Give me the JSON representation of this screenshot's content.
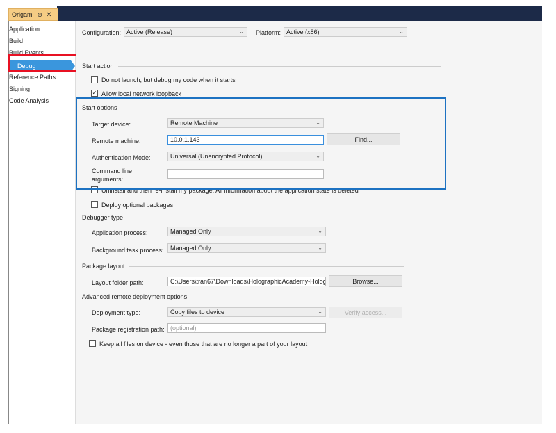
{
  "tab": {
    "title": "Origami",
    "pin_glyph": "⊕",
    "close_glyph": "✕"
  },
  "sidebar": {
    "items": [
      {
        "label": "Application"
      },
      {
        "label": "Build"
      },
      {
        "label": "Build Events"
      },
      {
        "label": "Debug"
      },
      {
        "label": "Reference Paths"
      },
      {
        "label": "Signing"
      },
      {
        "label": "Code Analysis"
      }
    ]
  },
  "config": {
    "configuration_label": "Configuration:",
    "configuration_value": "Active (Release)",
    "platform_label": "Platform:",
    "platform_value": "Active (x86)"
  },
  "start_action": {
    "title": "Start action",
    "do_not_launch": "Do not launch, but debug my code when it starts",
    "allow_loopback": "Allow local network loopback"
  },
  "start_options": {
    "title": "Start options",
    "target_device_label": "Target device:",
    "target_device_value": "Remote Machine",
    "remote_machine_label": "Remote machine:",
    "remote_machine_value": "10.0.1.143",
    "find_label": "Find...",
    "auth_mode_label": "Authentication Mode:",
    "auth_mode_value": "Universal (Unencrypted Protocol)",
    "cmdline_label_1": "Command line",
    "cmdline_label_2": "arguments:",
    "cmdline_value": "",
    "uninstall_label": "Uninstall and then re-install my package. All information about the application state is deleted",
    "deploy_optional_label": "Deploy optional packages"
  },
  "debugger_type": {
    "title": "Debugger type",
    "app_process_label": "Application process:",
    "app_process_value": "Managed Only",
    "bg_task_label": "Background task process:",
    "bg_task_value": "Managed Only"
  },
  "package_layout": {
    "title": "Package layout",
    "folder_label": "Layout folder path:",
    "folder_value": "C:\\Users\\tran67\\Downloads\\HolographicAcademy-Holog",
    "browse_label": "Browse..."
  },
  "deployment": {
    "title": "Advanced remote deployment options",
    "type_label": "Deployment type:",
    "type_value": "Copy files to device",
    "verify_label": "Verify access...",
    "reg_path_label": "Package registration path:",
    "reg_path_placeholder": "(optional)",
    "keep_files_label": "Keep all files on device - even those that are no longer a part of your layout"
  },
  "checks": {
    "do_not_launch": false,
    "allow_loopback": true,
    "uninstall": false,
    "deploy_optional": false,
    "keep_files": false
  },
  "colors": {
    "accent": "#3a96dd",
    "highlight_red": "#e81123",
    "highlight_blue": "#1d72c2",
    "titlebar": "#1c2a48",
    "tab": "#f5cc84"
  }
}
